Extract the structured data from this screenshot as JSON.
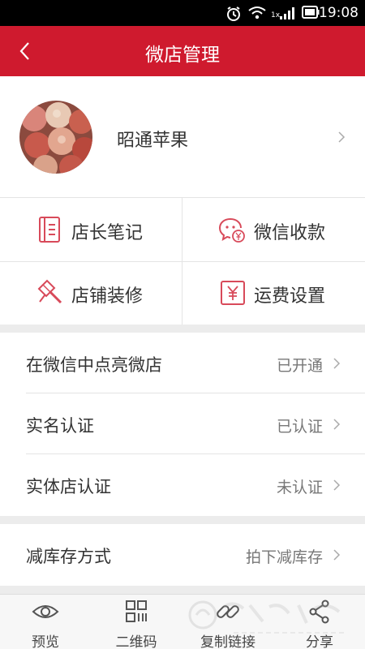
{
  "status_bar": {
    "time": "19:08",
    "network": "1x"
  },
  "header": {
    "title": "微店管理"
  },
  "profile": {
    "shop_name": "昭通苹果"
  },
  "grid": [
    {
      "label": "店长笔记",
      "icon": "notebook-icon"
    },
    {
      "label": "微信收款",
      "icon": "wechat-payment-icon"
    },
    {
      "label": "店铺装修",
      "icon": "paint-roller-icon"
    },
    {
      "label": "运费设置",
      "icon": "yuan-icon"
    }
  ],
  "settings": [
    {
      "label": "在微信中点亮微店",
      "value": "已开通"
    },
    {
      "label": "实名认证",
      "value": "已认证"
    },
    {
      "label": "实体店认证",
      "value": "未认证"
    }
  ],
  "inventory": {
    "label": "减库存方式",
    "value": "拍下减库存"
  },
  "tabs": [
    {
      "label": "预览",
      "icon": "eye-icon"
    },
    {
      "label": "二维码",
      "icon": "qr-code-icon"
    },
    {
      "label": "复制链接",
      "icon": "link-icon"
    },
    {
      "label": "分享",
      "icon": "share-icon"
    }
  ],
  "colors": {
    "brand": "#cf1a2e",
    "background": "#ececec",
    "text": "#333333",
    "secondary_text": "#777777"
  }
}
